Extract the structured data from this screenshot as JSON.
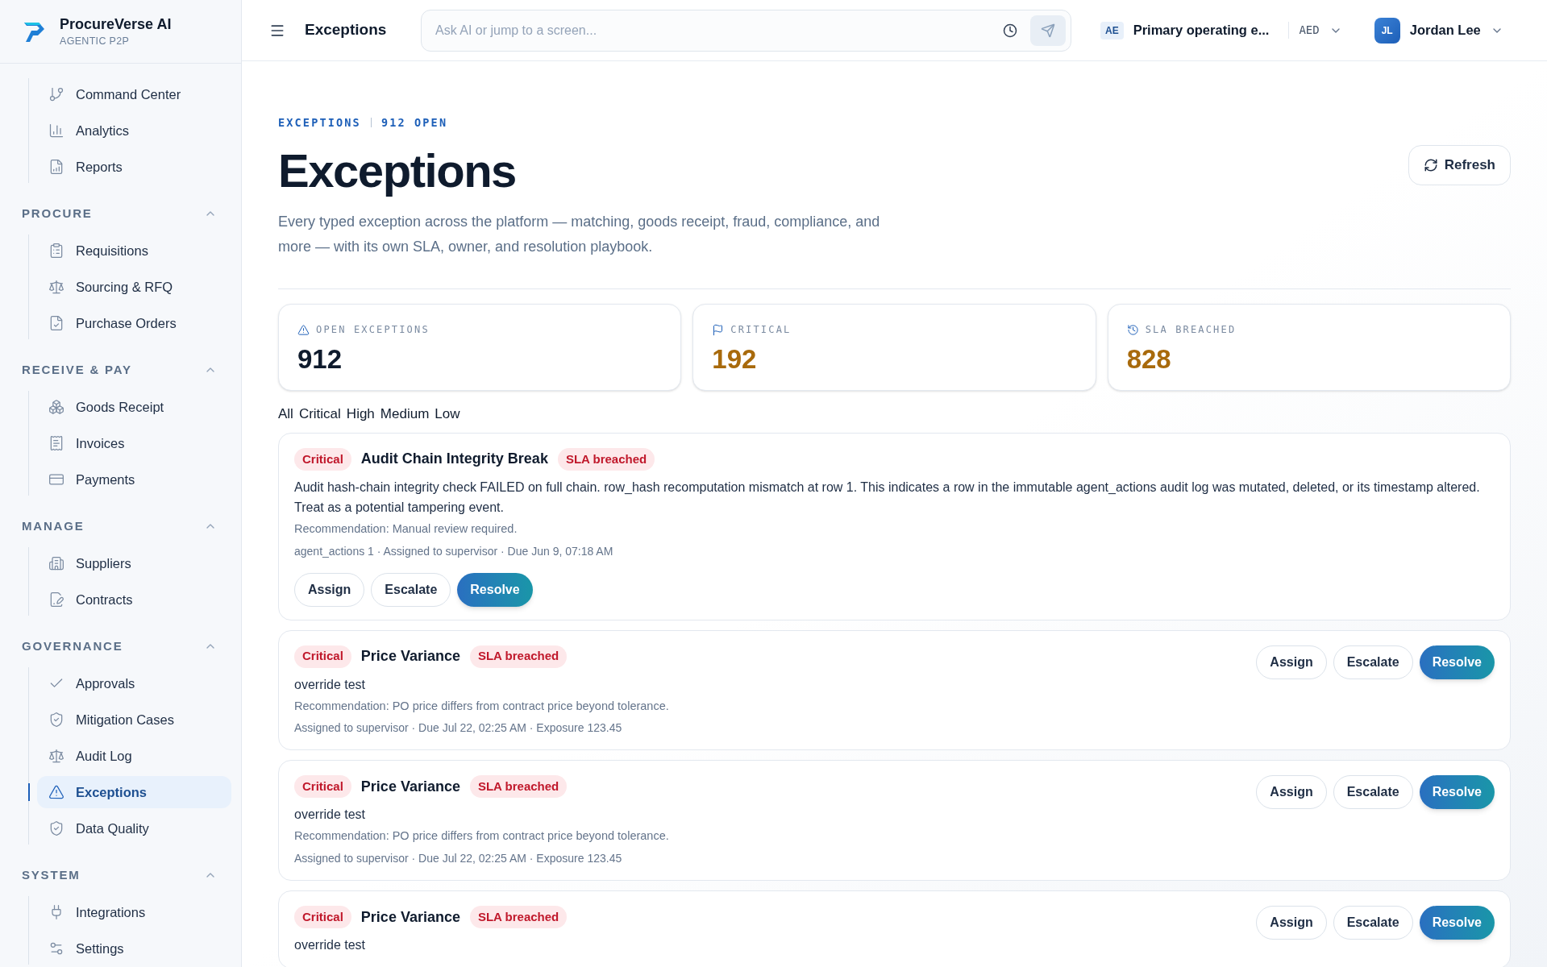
{
  "brand": {
    "name": "ProcureVerse AI",
    "tagline": "AGENTIC P2P"
  },
  "sidebar": {
    "groups": [
      {
        "items": [
          {
            "label": "Command Center",
            "selected": false
          },
          {
            "label": "Analytics",
            "selected": false
          },
          {
            "label": "Reports",
            "selected": false
          }
        ]
      },
      {
        "title": "PROCURE",
        "expanded": true,
        "items": [
          {
            "label": "Requisitions",
            "selected": false
          },
          {
            "label": "Sourcing & RFQ",
            "selected": false
          },
          {
            "label": "Purchase Orders",
            "selected": false
          }
        ]
      },
      {
        "title": "RECEIVE & PAY",
        "expanded": true,
        "items": [
          {
            "label": "Goods Receipt",
            "selected": false
          },
          {
            "label": "Invoices",
            "selected": false
          },
          {
            "label": "Payments",
            "selected": false
          }
        ]
      },
      {
        "title": "MANAGE",
        "expanded": true,
        "items": [
          {
            "label": "Suppliers",
            "selected": false
          },
          {
            "label": "Contracts",
            "selected": false
          }
        ]
      },
      {
        "title": "GOVERNANCE",
        "expanded": true,
        "items": [
          {
            "label": "Approvals",
            "selected": false
          },
          {
            "label": "Mitigation Cases",
            "selected": false
          },
          {
            "label": "Audit Log",
            "selected": false
          },
          {
            "label": "Exceptions",
            "selected": true
          },
          {
            "label": "Data Quality",
            "selected": false
          }
        ]
      },
      {
        "title": "SYSTEM",
        "expanded": true,
        "items": [
          {
            "label": "Integrations",
            "selected": false
          },
          {
            "label": "Settings",
            "selected": false
          }
        ]
      }
    ]
  },
  "topbar": {
    "title": "Exceptions",
    "search": {
      "placeholder": "Ask AI or jump to a screen..."
    },
    "entity_code": "AE",
    "entity": "Primary operating e...",
    "currency": "AED",
    "user": {
      "initials": "JL",
      "name": "Jordan Lee"
    }
  },
  "header": {
    "eyebrow": "EXCEPTIONS",
    "eyebrow_count": "912 OPEN",
    "title": "Exceptions",
    "description": "Every typed exception across the platform — matching, goods receipt, fraud, compliance, and more — with its own SLA, owner, and resolution playbook.",
    "refresh": "Refresh"
  },
  "stats": [
    {
      "label": "OPEN EXCEPTIONS",
      "value": "912",
      "color": "#0f1b2d"
    },
    {
      "label": "CRITICAL",
      "value": "192",
      "color": "#a86a0c"
    },
    {
      "label": "SLA BREACHED",
      "value": "828",
      "color": "#a86a0c"
    }
  ],
  "filters": [
    {
      "label": "All"
    },
    {
      "label": "Critical"
    },
    {
      "label": "High"
    },
    {
      "label": "Medium"
    },
    {
      "label": "Low"
    }
  ],
  "exceptions": [
    {
      "kind": "stacked",
      "severity": "Critical",
      "title": "Audit Chain Integrity Break",
      "sla": "SLA breached",
      "description": "Audit hash-chain integrity check FAILED on full chain. row_hash recomputation mismatch at row 1. This indicates a row in the immutable agent_actions audit log was mutated, deleted, or its timestamp altered. Treat as a potential tampering event.",
      "recommendation": "Recommendation: Manual review required.",
      "meta": "agent_actions 1 · Assigned to supervisor · Due Jun 9, 07:18 AM",
      "actions": [
        "Assign",
        "Escalate",
        "Resolve"
      ]
    },
    {
      "kind": "inline",
      "severity": "Critical",
      "title": "Price Variance",
      "sla": "SLA breached",
      "description": "override test",
      "recommendation": "Recommendation: PO price differs from contract price beyond tolerance.",
      "meta": "Assigned to supervisor · Due Jul 22, 02:25 AM · Exposure 123.45",
      "actions": [
        "Assign",
        "Escalate",
        "Resolve"
      ]
    },
    {
      "kind": "inline",
      "severity": "Critical",
      "title": "Price Variance",
      "sla": "SLA breached",
      "description": "override test",
      "recommendation": "Recommendation: PO price differs from contract price beyond tolerance.",
      "meta": "Assigned to supervisor · Due Jul 22, 02:25 AM · Exposure 123.45",
      "actions": [
        "Assign",
        "Escalate",
        "Resolve"
      ]
    },
    {
      "kind": "inline",
      "severity": "Critical",
      "title": "Price Variance",
      "sla": "SLA breached",
      "description": "override test",
      "actions": [
        "Assign",
        "Escalate",
        "Resolve"
      ]
    }
  ]
}
